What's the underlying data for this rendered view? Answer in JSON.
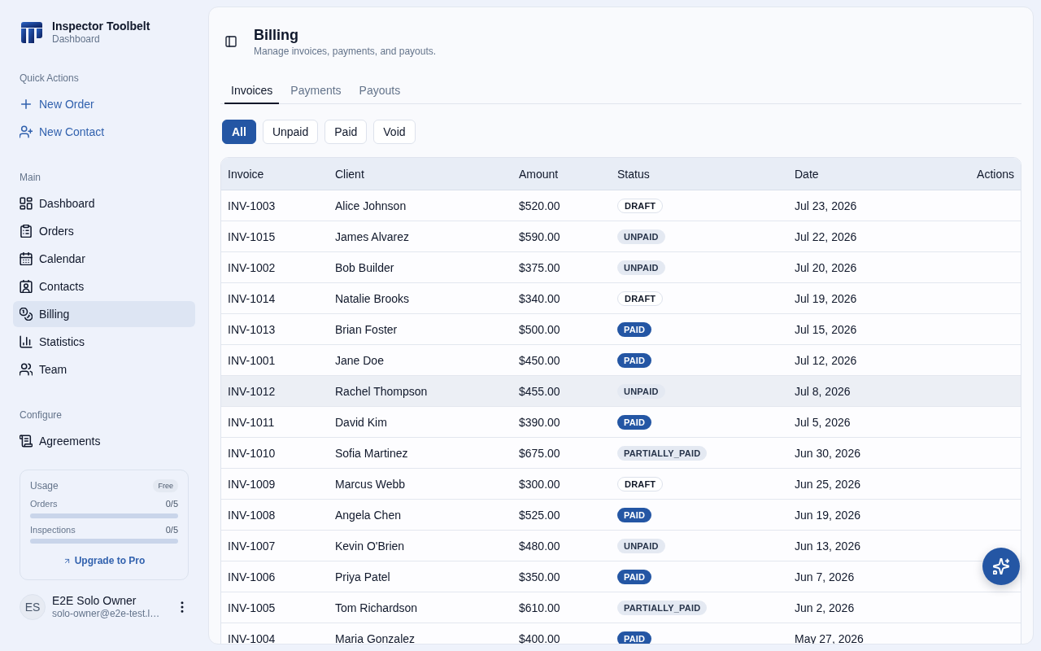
{
  "sidebar": {
    "brand": {
      "name": "Inspector Toolbelt",
      "subtitle": "Dashboard"
    },
    "sections": [
      {
        "heading": "Quick Actions",
        "kind": "actions",
        "items": [
          {
            "label": "New Order"
          },
          {
            "label": "New Contact"
          }
        ]
      },
      {
        "heading": "Main",
        "kind": "nav",
        "items": [
          {
            "label": "Dashboard",
            "selected": false
          },
          {
            "label": "Orders",
            "selected": false
          },
          {
            "label": "Calendar",
            "selected": false
          },
          {
            "label": "Contacts",
            "selected": false
          },
          {
            "label": "Billing",
            "selected": true
          },
          {
            "label": "Statistics",
            "selected": false
          },
          {
            "label": "Team",
            "selected": false
          }
        ]
      },
      {
        "heading": "Configure",
        "kind": "nav",
        "items": [
          {
            "label": "Agreements",
            "selected": false
          }
        ]
      }
    ],
    "usage": {
      "title": "Usage",
      "plan": "Free",
      "meters": [
        {
          "label": "Orders",
          "reading": "0/5",
          "level": 0
        },
        {
          "label": "Inspections",
          "reading": "0/5",
          "level": 0
        }
      ],
      "link": "Upgrade to Pro"
    },
    "user": {
      "initials": "ES",
      "name": "E2E Solo Owner",
      "email": "solo-owner@e2e-test.l…"
    }
  },
  "main": {
    "title": "Billing",
    "subtitle": "Manage invoices, payments, and payouts.",
    "tabs": [
      {
        "label": "Invoices",
        "selected": true
      },
      {
        "label": "Payments",
        "selected": false
      },
      {
        "label": "Payouts",
        "selected": false
      }
    ],
    "filters": [
      {
        "label": "All",
        "selected": true
      },
      {
        "label": "Unpaid",
        "selected": false
      },
      {
        "label": "Paid",
        "selected": false
      },
      {
        "label": "Void",
        "selected": false
      }
    ],
    "table": {
      "columns": [
        "Invoice",
        "Client",
        "Amount",
        "Status",
        "Date",
        "Actions"
      ],
      "rows": [
        {
          "invoice": "INV-1003",
          "client": "Alice Johnson",
          "amount": "$520.00",
          "status": {
            "label": "DRAFT",
            "kind": "draft"
          },
          "date": "Jul 23, 2026",
          "highlighted": false
        },
        {
          "invoice": "INV-1015",
          "client": "James Alvarez",
          "amount": "$590.00",
          "status": {
            "label": "UNPAID",
            "kind": "unpaid"
          },
          "date": "Jul 22, 2026",
          "highlighted": false
        },
        {
          "invoice": "INV-1002",
          "client": "Bob Builder",
          "amount": "$375.00",
          "status": {
            "label": "UNPAID",
            "kind": "unpaid"
          },
          "date": "Jul 20, 2026",
          "highlighted": false
        },
        {
          "invoice": "INV-1014",
          "client": "Natalie Brooks",
          "amount": "$340.00",
          "status": {
            "label": "DRAFT",
            "kind": "draft"
          },
          "date": "Jul 19, 2026",
          "highlighted": false
        },
        {
          "invoice": "INV-1013",
          "client": "Brian Foster",
          "amount": "$500.00",
          "status": {
            "label": "PAID",
            "kind": "paid"
          },
          "date": "Jul 15, 2026",
          "highlighted": false
        },
        {
          "invoice": "INV-1001",
          "client": "Jane Doe",
          "amount": "$450.00",
          "status": {
            "label": "PAID",
            "kind": "paid"
          },
          "date": "Jul 12, 2026",
          "highlighted": false
        },
        {
          "invoice": "INV-1012",
          "client": "Rachel Thompson",
          "amount": "$455.00",
          "status": {
            "label": "UNPAID",
            "kind": "unpaid"
          },
          "date": "Jul 8, 2026",
          "highlighted": true
        },
        {
          "invoice": "INV-1011",
          "client": "David Kim",
          "amount": "$390.00",
          "status": {
            "label": "PAID",
            "kind": "paid"
          },
          "date": "Jul 5, 2026",
          "highlighted": false
        },
        {
          "invoice": "INV-1010",
          "client": "Sofia Martinez",
          "amount": "$675.00",
          "status": {
            "label": "PARTIALLY_PAID",
            "kind": "partial"
          },
          "date": "Jun 30, 2026",
          "highlighted": false
        },
        {
          "invoice": "INV-1009",
          "client": "Marcus Webb",
          "amount": "$300.00",
          "status": {
            "label": "DRAFT",
            "kind": "draft"
          },
          "date": "Jun 25, 2026",
          "highlighted": false
        },
        {
          "invoice": "INV-1008",
          "client": "Angela Chen",
          "amount": "$525.00",
          "status": {
            "label": "PAID",
            "kind": "paid"
          },
          "date": "Jun 19, 2026",
          "highlighted": false
        },
        {
          "invoice": "INV-1007",
          "client": "Kevin O'Brien",
          "amount": "$480.00",
          "status": {
            "label": "UNPAID",
            "kind": "unpaid"
          },
          "date": "Jun 13, 2026",
          "highlighted": false
        },
        {
          "invoice": "INV-1006",
          "client": "Priya Patel",
          "amount": "$350.00",
          "status": {
            "label": "PAID",
            "kind": "paid"
          },
          "date": "Jun 7, 2026",
          "highlighted": false
        },
        {
          "invoice": "INV-1005",
          "client": "Tom Richardson",
          "amount": "$610.00",
          "status": {
            "label": "PARTIALLY_PAID",
            "kind": "partial"
          },
          "date": "Jun 2, 2026",
          "highlighted": false
        },
        {
          "invoice": "INV-1004",
          "client": "Maria Gonzalez",
          "amount": "$400.00",
          "status": {
            "label": "PAID",
            "kind": "paid"
          },
          "date": "May 27, 2026",
          "highlighted": false
        }
      ]
    }
  }
}
